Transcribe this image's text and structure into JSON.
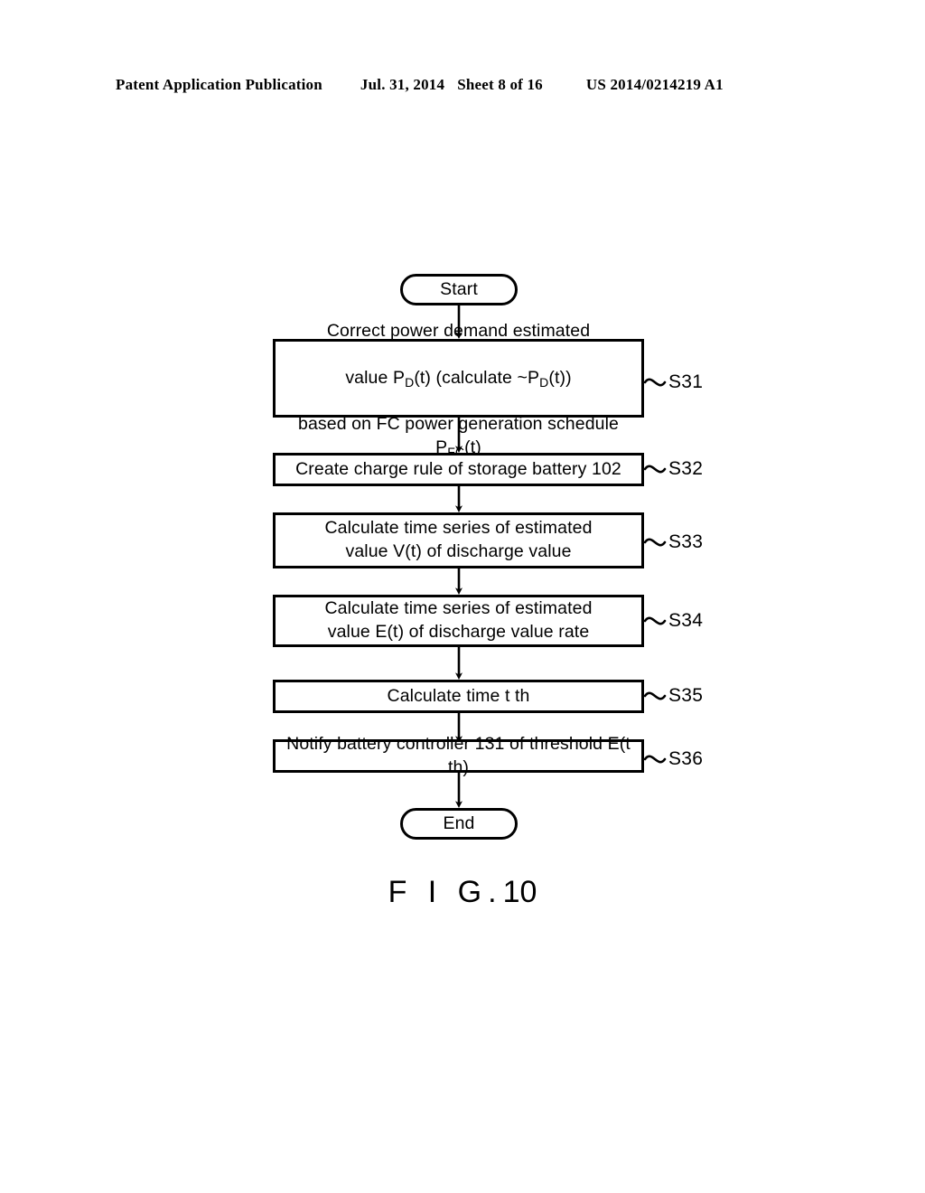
{
  "header": {
    "publication": "Patent Application Publication",
    "date": "Jul. 31, 2014",
    "sheet": "Sheet 8 of 16",
    "patent_number": "US 2014/0214219 A1"
  },
  "figure": {
    "caption_word": "F I G.",
    "caption_number": "10",
    "caption_full": "F I G. 10"
  },
  "flowchart": {
    "start_label": "Start",
    "end_label": "End",
    "steps": [
      {
        "id": "S31",
        "label": "S31",
        "text": "Correct power demand estimated value PD(t) (calculate ~PD(t)) based on FC power generation schedule PFC(t)",
        "line1": "Correct power demand estimated",
        "line2_a": "value P",
        "line2_sub": "D",
        "line2_b": "(t) (calculate ",
        "line2_tilde": "~",
        "line2_c": "P",
        "line2_sub2": "D",
        "line2_d": "(t))",
        "line3_a": "based on FC power generation schedule P",
        "line3_sub": "FC",
        "line3_b": "(t)"
      },
      {
        "id": "S32",
        "label": "S32",
        "text": "Create charge rule of storage battery 102"
      },
      {
        "id": "S33",
        "label": "S33",
        "text": "Calculate time series of estimated\nvalue V(t) of discharge value"
      },
      {
        "id": "S34",
        "label": "S34",
        "text": "Calculate time series of estimated\nvalue E(t) of discharge value rate"
      },
      {
        "id": "S35",
        "label": "S35",
        "text": "Calculate time t th"
      },
      {
        "id": "S36",
        "label": "S36",
        "text": "Notify battery controller 131 of threshold E(t th)"
      }
    ]
  },
  "colors": {
    "ink": "#000000",
    "paper": "#ffffff"
  }
}
